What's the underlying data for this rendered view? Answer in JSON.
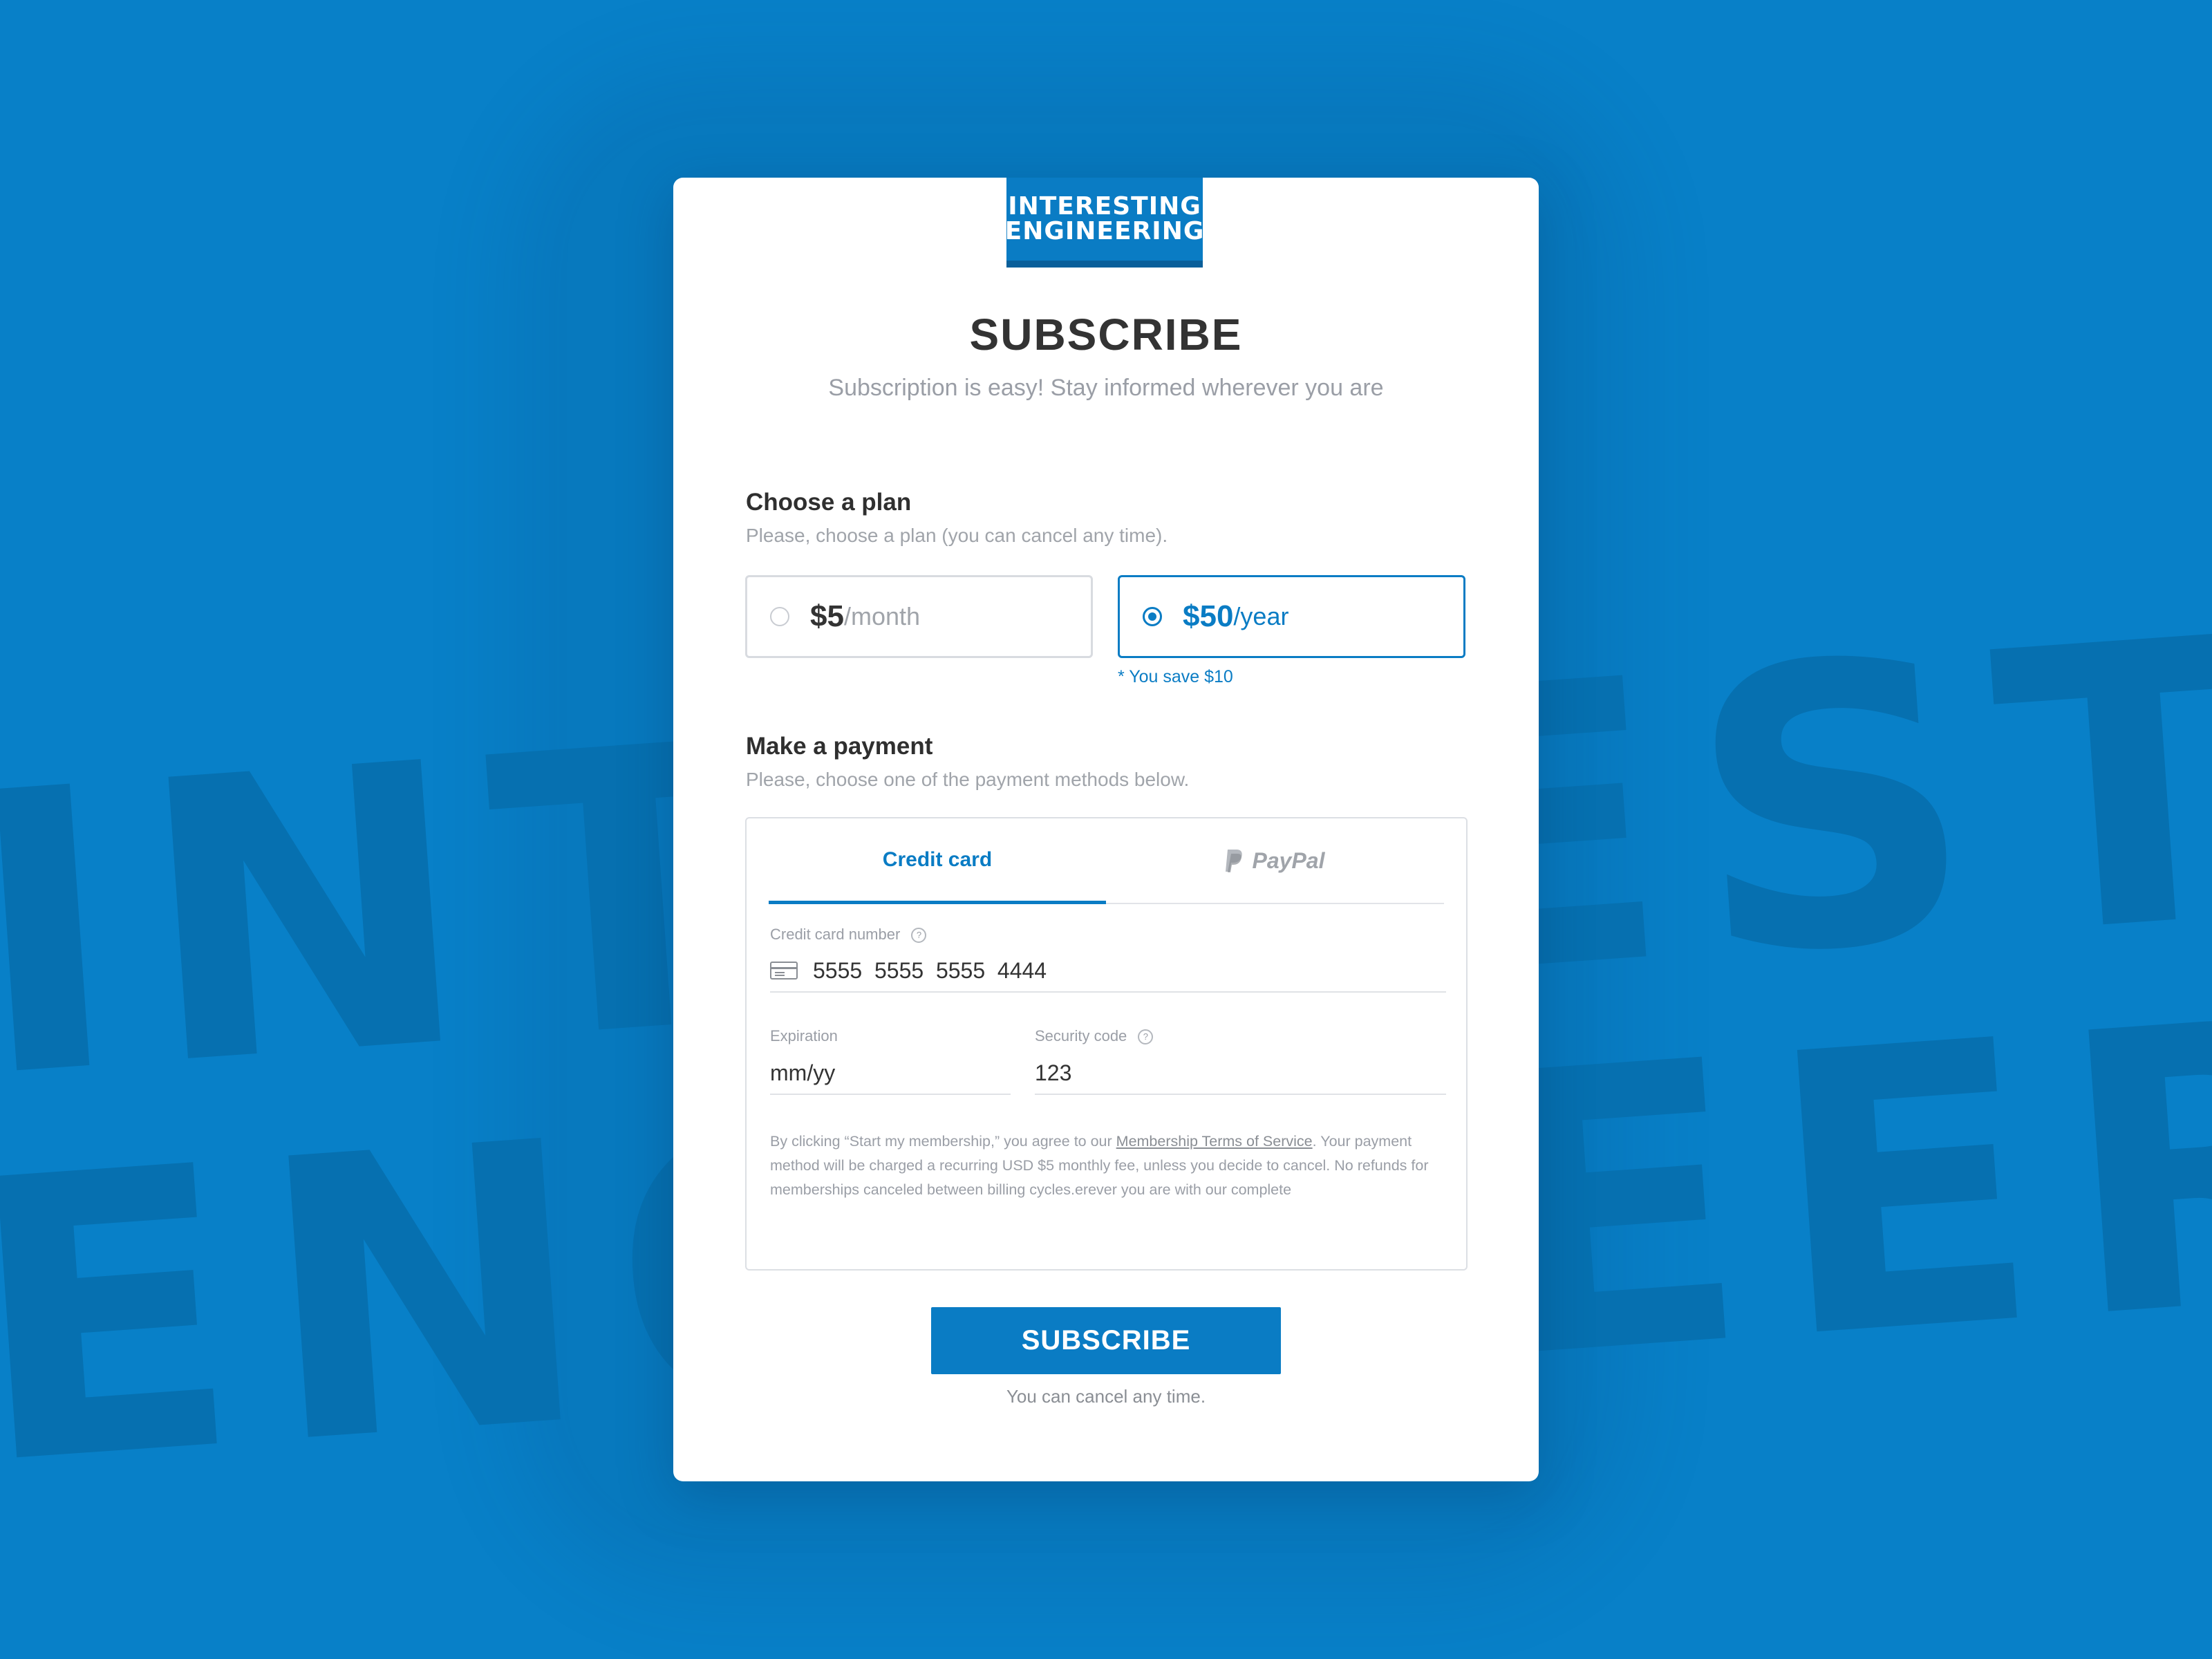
{
  "brand": {
    "logo_line1": "INTERESTING",
    "logo_line2": "ENGINEERING",
    "background_line1": "INTERESTING",
    "background_line2": "ENGINEERING",
    "accent_color": "#0a7cc4",
    "background_color": "#0880c8"
  },
  "header": {
    "title": "SUBSCRIBE",
    "subtitle": "Subscription is easy! Stay informed wherever you are"
  },
  "plan_section": {
    "heading": "Choose a plan",
    "description": "Please, choose a plan (you can cancel any time).",
    "plans": [
      {
        "price": "$5",
        "period": "/month",
        "selected": false
      },
      {
        "price": "$50",
        "period": "/year",
        "selected": true
      }
    ],
    "save_note": "* You save $10"
  },
  "payment_section": {
    "heading": "Make a payment",
    "description": "Please, choose one of the payment methods below.",
    "tabs": [
      {
        "label": "Credit card",
        "active": true
      },
      {
        "label": "PayPal",
        "icon": "paypal-icon",
        "active": false
      }
    ],
    "card_number_label": "Credit card number",
    "card_number_value": "5555  5555  5555  4444",
    "expiration_label": "Expiration",
    "expiration_placeholder": "mm/yy",
    "security_label": "Security code",
    "security_value": "123",
    "legal_prefix": "By clicking “Start my membership,” you agree to our ",
    "legal_link": "Membership Terms of Service",
    "legal_suffix": ". Your payment method will be charged a recurring USD $5 monthly fee, unless you decide to cancel. No refunds for memberships canceled between billing cycles.erever you are with our complete"
  },
  "footer": {
    "subscribe_label": "SUBSCRIBE",
    "cancel_note": "You can cancel any time."
  }
}
